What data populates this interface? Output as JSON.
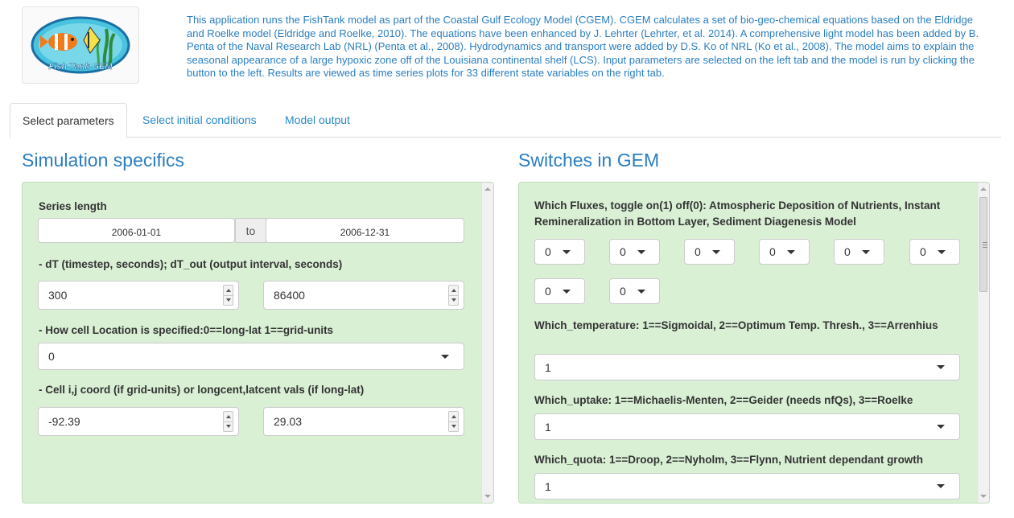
{
  "logo": {
    "alt": "Fish Tank GEM",
    "text": "Fish Tank GEM"
  },
  "intro": "This application runs the FishTank model as part of the Coastal Gulf Ecology Model (CGEM). CGEM calculates a set of bio-geo-chemical equations based on the Eldridge and Roelke model (Eldridge and Roelke, 2010). The equations have been enhanced by J. Lehrter (Lehrter, et al. 2014). A comprehensive light model has been added by B. Penta of the Naval Research Lab (NRL) (Penta et al., 2008). Hydrodynamics and transport were added by D.S. Ko of NRL (Ko et al., 2008). The model aims to explain the seasonal appearance of a large hypoxic zone off of the Louisiana continental shelf (LCS). Input parameters are selected on the left tab and the model is run by clicking the button to the left. Results are viewed as time series plots for 33 different state variables on the right tab.",
  "tabs": [
    {
      "label": "Select parameters"
    },
    {
      "label": "Select initial conditions"
    },
    {
      "label": "Model output"
    }
  ],
  "left": {
    "title": "Simulation specifics",
    "series_label": "Series length",
    "date_start": "2006-01-01",
    "date_sep": "to",
    "date_end": "2006-12-31",
    "dt_label": "- dT (timestep, seconds); dT_out (output interval, seconds)",
    "dt_value": "300",
    "dt_out_value": "86400",
    "loc_label": "- How cell Location is specified:0==long-lat 1==grid-units",
    "loc_value": "0",
    "coord_label": "- Cell i,j coord (if grid-units) or longcent,latcent vals (if long-lat)",
    "coord_i": "-92.39",
    "coord_j": "29.03"
  },
  "right": {
    "title": "Switches in GEM",
    "flux_label": "Which Fluxes, toggle on(1) off(0): Atmospheric Deposition of Nutrients, Instant Remineralization in Bottom Layer, Sediment Diagenesis Model",
    "flux_values": [
      "0",
      "0",
      "0",
      "0",
      "0",
      "0",
      "0",
      "0"
    ],
    "temp_label": "Which_temperature: 1==Sigmoidal, 2==Optimum Temp. Thresh., 3==Arrenhius",
    "temp_value": "1",
    "uptake_label": "Which_uptake: 1==Michaelis-Menten, 2==Geider (needs nfQs), 3==Roelke",
    "uptake_value": "1",
    "quota_label": "Which_quota: 1==Droop, 2==Nyholm, 3==Flynn, Nutrient dependant growth",
    "quota_value": "1"
  },
  "colors": {
    "accent": "#2a7ec0",
    "panel_bg": "#d9f0d5",
    "link": "#2a8ac9"
  }
}
